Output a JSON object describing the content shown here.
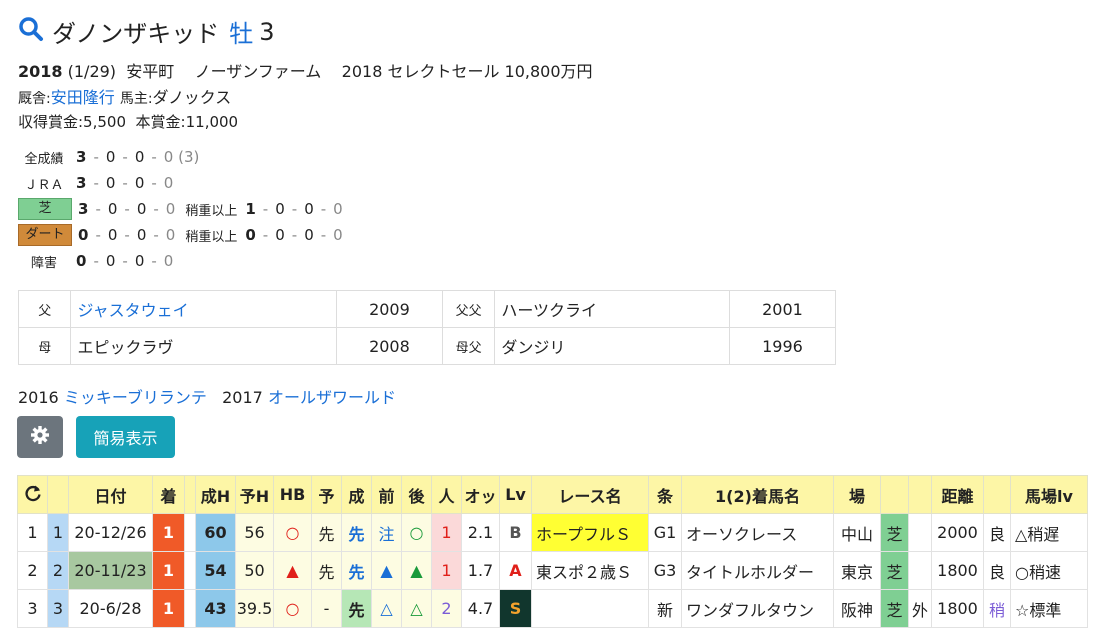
{
  "horse": {
    "name": "ダノンザキッド",
    "sex": "牡",
    "age": "3",
    "birth_year": "2018",
    "birth_date": "(1/29)",
    "birthplace": "安平町",
    "breeder": "ノーザンファーム",
    "sale": "2018 セレクトセール 10,800万円",
    "trainer_label": "厩舎:",
    "trainer": "安田隆行",
    "owner_label": "馬主:",
    "owner": "ダノックス",
    "earnings": "収得賞金:5,500",
    "prize": "本賞金:11,000"
  },
  "stats": {
    "all": {
      "label": "全成績",
      "w": "3",
      "rest": [
        "0",
        "0",
        "0"
      ],
      "extra": "(3)"
    },
    "jra": {
      "label": "ＪＲＡ",
      "w": "3",
      "rest": [
        "0",
        "0",
        "0"
      ]
    },
    "turf": {
      "label": "芝",
      "w": "3",
      "rest": [
        "0",
        "0",
        "0"
      ],
      "sub_label": "稍重以上",
      "sub_w": "1",
      "sub_rest": [
        "0",
        "0",
        "0"
      ]
    },
    "dirt": {
      "label": "ダート",
      "w": "0",
      "rest": [
        "0",
        "0",
        "0"
      ],
      "sub_label": "稍重以上",
      "sub_w": "0",
      "sub_rest": [
        "0",
        "0",
        "0"
      ]
    },
    "jump": {
      "label": "障害",
      "w": "0",
      "rest": [
        "0",
        "0",
        "0"
      ]
    },
    "dash": "-"
  },
  "pedigree": {
    "sire_label": "父",
    "sire": "ジャスタウェイ",
    "sire_year": "2009",
    "sire_sire_label": "父父",
    "sire_sire": "ハーツクライ",
    "sire_sire_year": "2001",
    "dam_label": "母",
    "dam": "エピックラヴ",
    "dam_year": "2008",
    "dam_sire_label": "母父",
    "dam_sire": "ダンジリ",
    "dam_sire_year": "1996"
  },
  "siblings": [
    {
      "year": "2016",
      "name": "ミッキーブリランテ"
    },
    {
      "year": "2017",
      "name": "オールザワールド"
    }
  ],
  "buttons": {
    "easy": "簡易表示"
  },
  "table": {
    "headers": [
      "",
      "",
      "日付",
      "着",
      "",
      "成H",
      "予H",
      "HB",
      "予",
      "成",
      "前",
      "後",
      "人",
      "オッ",
      "Lv",
      "レース名",
      "条",
      "1(2)着馬名",
      "場",
      "",
      "",
      "距離",
      "",
      "馬場lv"
    ],
    "rows": [
      [
        "1",
        "1",
        "20-12/26",
        "1",
        "",
        "60",
        "56",
        "○",
        "先",
        "先",
        "注",
        "○",
        "1",
        "2.1",
        "B",
        "ホープフルＳ",
        "G1",
        "オーソクレース",
        "中山",
        "芝",
        "",
        "2000",
        "良",
        "△稍遅"
      ],
      [
        "2",
        "2",
        "20-11/23",
        "1",
        "",
        "54",
        "50",
        "▲",
        "先",
        "先",
        "▲",
        "▲",
        "1",
        "1.7",
        "A",
        "東スポ２歳Ｓ",
        "G3",
        "タイトルホルダー",
        "東京",
        "芝",
        "",
        "1800",
        "良",
        "○稍速"
      ],
      [
        "3",
        "3",
        "20-6/28",
        "1",
        "",
        "43",
        "39.5",
        "○",
        "-",
        "先",
        "△",
        "△",
        "2",
        "4.7",
        "S",
        "",
        "新",
        "ワンダフルタウン",
        "阪神",
        "芝",
        "外",
        "1800",
        "稍",
        "☆標準"
      ]
    ]
  },
  "colors": {
    "link": "#1a6fd6",
    "header": "#fdf6a6",
    "rank": "#f05a28",
    "turf": "#7fcf93",
    "dirt": "#d08a3a"
  }
}
